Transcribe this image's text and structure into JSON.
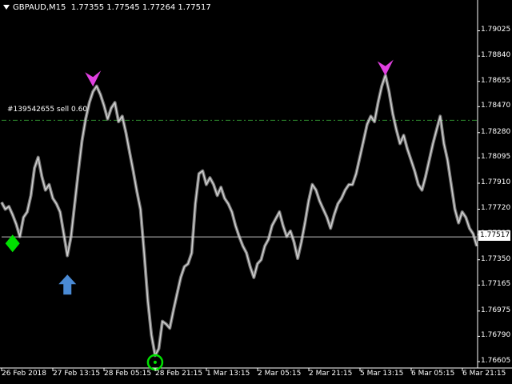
{
  "header": {
    "symbol_timeframe": "GBPAUD,M15",
    "ohlc": "1.77355 1.77545 1.77264 1.77517"
  },
  "order_line": {
    "label": "#139542655 sell 0.60",
    "price": 1.7837,
    "color": "#2e8b2e"
  },
  "current_price": {
    "label": "1.77517",
    "value": 1.77517
  },
  "price_axis": {
    "ticks": [
      "1.79025",
      "1.78840",
      "1.78655",
      "1.78470",
      "1.78280",
      "1.78095",
      "1.77910",
      "1.77720",
      "1.77535",
      "1.77350",
      "1.77165",
      "1.76975",
      "1.76790",
      "1.76605"
    ]
  },
  "time_axis": {
    "labels": [
      "26 Feb 2018",
      "27 Feb 13:15",
      "28 Feb 05:15",
      "28 Feb 21:15",
      "1 Mar 13:15",
      "2 Mar 05:15",
      "2 Mar 21:15",
      "5 Mar 13:15",
      "6 Mar 05:15",
      "6 Mar 21:15"
    ]
  },
  "colors": {
    "background": "#000000",
    "price_line": "#cfcfcf",
    "signal_buy_diamond": "#00e000",
    "signal_buy_arrow": "#4a8ad4",
    "signal_sell_arrow": "#e040e0",
    "signal_circle": "#00e000"
  },
  "chart_data": {
    "type": "line",
    "ylim": [
      1.7657,
      1.7918
    ],
    "price_series": [
      1.7777,
      1.7772,
      1.7774,
      1.7768,
      1.7761,
      1.7752,
      1.7766,
      1.777,
      1.7782,
      1.7802,
      1.781,
      1.7796,
      1.7786,
      1.779,
      1.778,
      1.7776,
      1.777,
      1.7754,
      1.7738,
      1.7752,
      1.7776,
      1.78,
      1.7822,
      1.7838,
      1.785,
      1.7858,
      1.7862,
      1.7856,
      1.7848,
      1.7838,
      1.7846,
      1.785,
      1.7836,
      1.784,
      1.7828,
      1.7814,
      1.78,
      1.7785,
      1.7772,
      1.774,
      1.7705,
      1.768,
      1.7665,
      1.767,
      1.769,
      1.7688,
      1.7685,
      1.7698,
      1.771,
      1.7722,
      1.773,
      1.7732,
      1.774,
      1.7776,
      1.7798,
      1.78,
      1.779,
      1.7795,
      1.779,
      1.7782,
      1.7788,
      1.778,
      1.7776,
      1.777,
      1.776,
      1.7752,
      1.7745,
      1.774,
      1.773,
      1.7722,
      1.7732,
      1.7735,
      1.7745,
      1.775,
      1.776,
      1.7765,
      1.777,
      1.776,
      1.7752,
      1.7756,
      1.7748,
      1.7736,
      1.7748,
      1.7762,
      1.7778,
      1.779,
      1.7786,
      1.7778,
      1.7772,
      1.7766,
      1.7758,
      1.7768,
      1.7776,
      1.778,
      1.7786,
      1.779,
      1.779,
      1.7798,
      1.781,
      1.7822,
      1.7834,
      1.784,
      1.7836,
      1.785,
      1.7862,
      1.787,
      1.7858,
      1.7842,
      1.783,
      1.782,
      1.7826,
      1.7816,
      1.7808,
      1.78,
      1.779,
      1.7786,
      1.7796,
      1.7808,
      1.782,
      1.783,
      1.784,
      1.782,
      1.7808,
      1.779,
      1.7772,
      1.7762,
      1.777,
      1.7766,
      1.7758,
      1.7754,
      1.7745
    ],
    "signals": [
      {
        "type": "buy-diamond",
        "price": 1.7747
      },
      {
        "type": "buy-arrow",
        "price": 1.773
      },
      {
        "type": "sell-arrow",
        "price": 1.7864
      },
      {
        "type": "circle",
        "price": 1.766
      },
      {
        "type": "sell-arrow",
        "price": 1.7872
      }
    ]
  }
}
